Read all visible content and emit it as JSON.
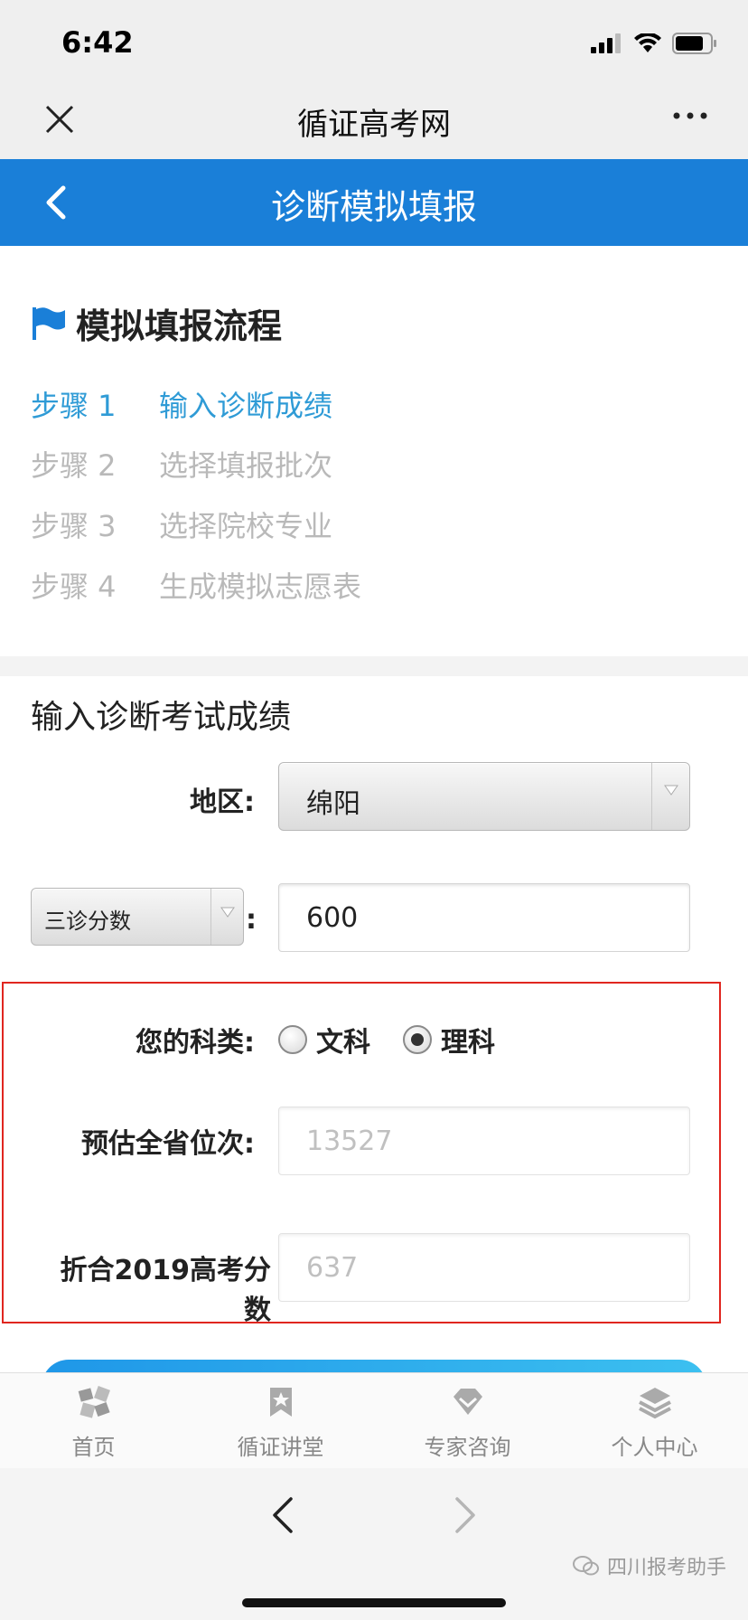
{
  "status_bar": {
    "time": "6:42"
  },
  "wechat_header": {
    "title": "循证高考网"
  },
  "page_header": {
    "title": "诊断模拟填报"
  },
  "flow": {
    "title": "模拟填报流程",
    "steps": [
      {
        "num": "步骤 1",
        "label": "输入诊断成绩"
      },
      {
        "num": "步骤 2",
        "label": "选择填报批次"
      },
      {
        "num": "步骤 3",
        "label": "选择院校专业"
      },
      {
        "num": "步骤 4",
        "label": "生成模拟志愿表"
      }
    ]
  },
  "score_form": {
    "title": "输入诊断考试成绩",
    "region_label": "地区:",
    "region_value": "绵阳",
    "exam_select_value": "三诊分数",
    "exam_colon": ":",
    "score_value": "600",
    "subject_label": "您的科类:",
    "subject_options": [
      "文科",
      "理科"
    ],
    "subject_selected": "理科",
    "rank_label": "预估全省位次:",
    "rank_value": "13527",
    "converted_label": "折合2019高考分数",
    "converted_value": "637"
  },
  "tabs": [
    {
      "label": "首页",
      "icon": "home-icon"
    },
    {
      "label": "循证讲堂",
      "icon": "bookmark-star-icon"
    },
    {
      "label": "专家咨询",
      "icon": "diamond-icon"
    },
    {
      "label": "个人中心",
      "icon": "layers-icon"
    }
  ],
  "watermark": {
    "text": "四川报考助手"
  },
  "colors": {
    "primary_blue": "#1a7fd8",
    "step_active": "#2f9bd6",
    "highlight_red": "#e0261f"
  }
}
